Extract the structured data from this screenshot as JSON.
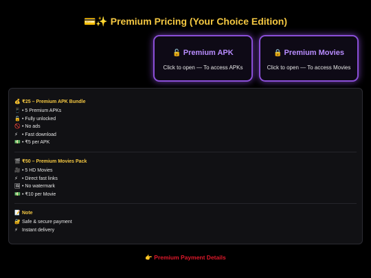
{
  "page": {
    "title_icon": "💳✨",
    "title": "Premium Pricing (Your Choice Edition)"
  },
  "cards": [
    {
      "icon": "🔓",
      "title": "Premium APK",
      "subtitle": "Click to open — To access APKs"
    },
    {
      "icon": "🔒",
      "title": "Premium Movies",
      "subtitle": "Click to open — To access Movies"
    }
  ],
  "sections": {
    "apk": {
      "icon": "💰",
      "title": "₹25 – Premium APK Bundle",
      "items": [
        {
          "icon": "📱",
          "text": "• 5 Premium APKs"
        },
        {
          "icon": "🔓",
          "text": "• Fully unlocked"
        },
        {
          "icon": "🚫",
          "text": "• No ads"
        },
        {
          "icon": "⚡",
          "text": "• Fast download"
        },
        {
          "icon": "💵",
          "text": "• ₹5 per APK"
        }
      ]
    },
    "movies": {
      "icon": "🎬",
      "title": "₹50 – Premium Movies Pack",
      "items": [
        {
          "icon": "🎥",
          "text": "• 5 HD Movies"
        },
        {
          "icon": "⚡",
          "text": "• Direct fast links"
        },
        {
          "icon": "🖼",
          "text": "• No watermark"
        },
        {
          "icon": "💵",
          "text": "• ₹10 per Movie"
        }
      ]
    },
    "note": {
      "icon": "📝",
      "title": "Note",
      "items": [
        {
          "icon": "🔐",
          "text": "Safe & secure payment"
        },
        {
          "icon": "⚡",
          "text": "Instant delivery"
        }
      ]
    }
  },
  "footer": {
    "icon": "👉",
    "label": "Premium Payment Details"
  },
  "colors": {
    "accent_gold": "#f5c842",
    "accent_purple": "#8b4fd8",
    "card_title": "#b88cff",
    "link_red": "#e0192b"
  }
}
